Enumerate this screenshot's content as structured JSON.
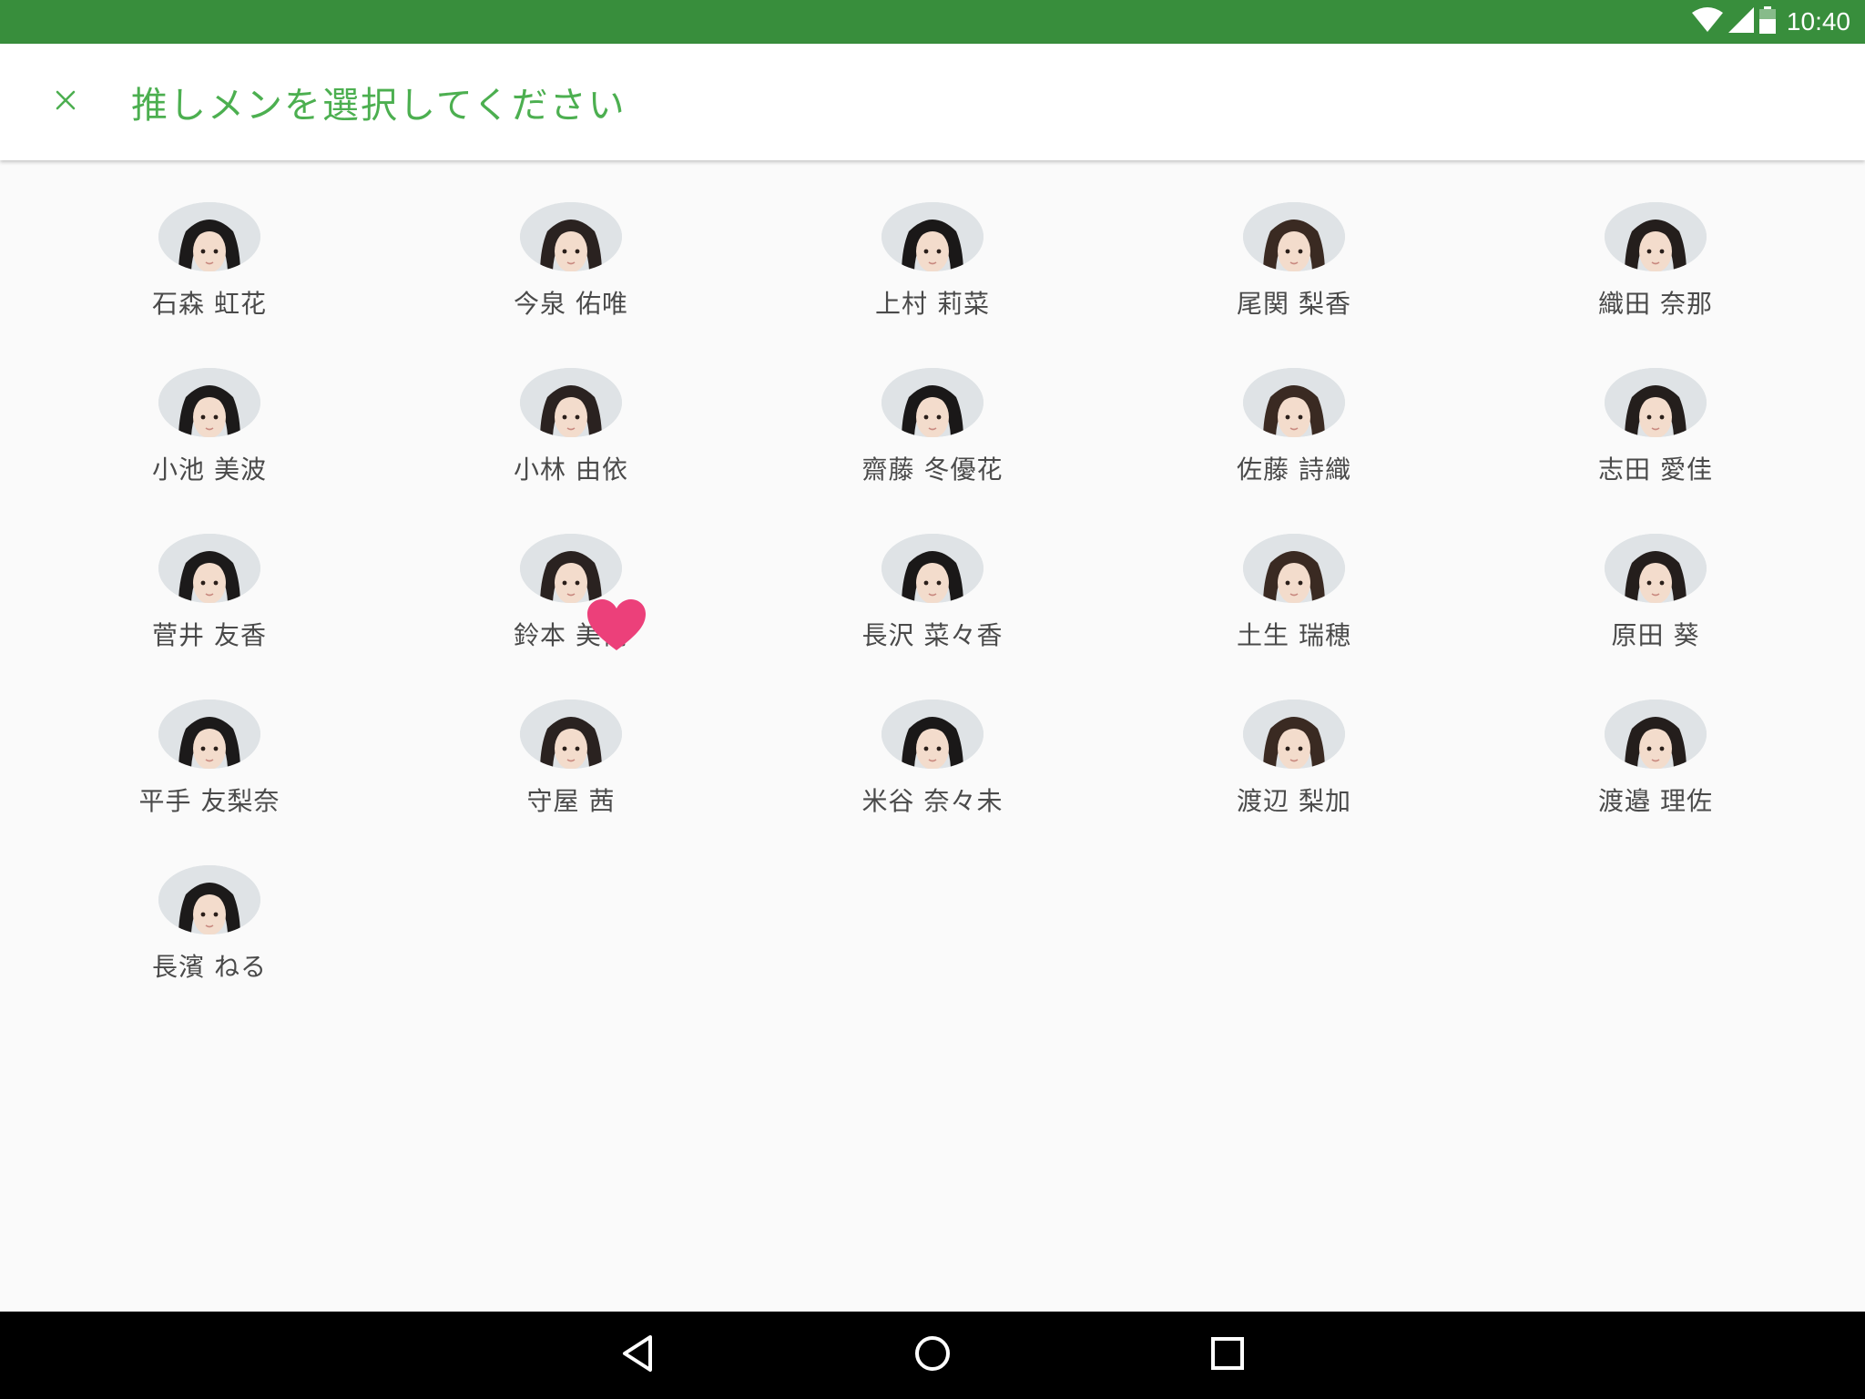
{
  "status_bar": {
    "time": "10:40",
    "icons": [
      "wifi-icon",
      "cell-signal-icon",
      "battery-icon"
    ],
    "color": "#388e3c"
  },
  "toolbar": {
    "close_icon": "close-icon",
    "title": "推しメンを選択してください",
    "accent_color": "#4caf50"
  },
  "members": [
    {
      "name": "石森 虹花",
      "favorite": false
    },
    {
      "name": "今泉 佑唯",
      "favorite": false
    },
    {
      "name": "上村 莉菜",
      "favorite": false
    },
    {
      "name": "尾関 梨香",
      "favorite": false
    },
    {
      "name": "織田 奈那",
      "favorite": false
    },
    {
      "name": "小池 美波",
      "favorite": false
    },
    {
      "name": "小林 由依",
      "favorite": false
    },
    {
      "name": "齋藤 冬優花",
      "favorite": false
    },
    {
      "name": "佐藤 詩織",
      "favorite": false
    },
    {
      "name": "志田 愛佳",
      "favorite": false
    },
    {
      "name": "菅井 友香",
      "favorite": false
    },
    {
      "name": "鈴本 美愉",
      "favorite": true
    },
    {
      "name": "長沢 菜々香",
      "favorite": false
    },
    {
      "name": "土生 瑞穂",
      "favorite": false
    },
    {
      "name": "原田 葵",
      "favorite": false
    },
    {
      "name": "平手 友梨奈",
      "favorite": false
    },
    {
      "name": "守屋 茜",
      "favorite": false
    },
    {
      "name": "米谷 奈々未",
      "favorite": false
    },
    {
      "name": "渡辺 梨加",
      "favorite": false
    },
    {
      "name": "渡邉 理佐",
      "favorite": false
    },
    {
      "name": "長濱 ねる",
      "favorite": false
    }
  ],
  "favorite_color": "#ec407a",
  "nav_bar": {
    "icons": [
      "back-icon",
      "home-icon",
      "recents-icon"
    ]
  }
}
